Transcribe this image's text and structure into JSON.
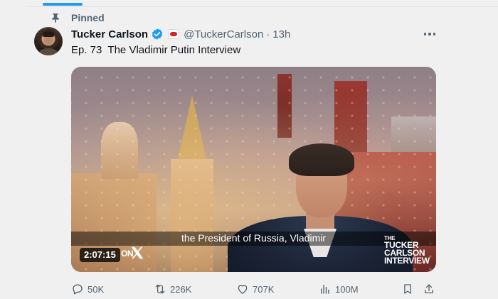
{
  "colors": {
    "accent": "#1d9bf0",
    "muted": "#536471",
    "text": "#0f1419"
  },
  "pinned": {
    "label": "Pinned",
    "icon": "pin-icon"
  },
  "tweet": {
    "display_name": "Tucker Carlson",
    "handle": "@TuckerCarlson",
    "separator": "·",
    "time": "13h",
    "text": "Ep. 73  The Vladimir Putin Interview"
  },
  "media": {
    "caption": "the President of Russia, Vladimir",
    "duration": "2:07:15",
    "brand_fragment": "ON",
    "watermark": {
      "line1": "THE",
      "line2": "TUCKER",
      "line3": "CARLSON",
      "line4": "INTERVIEW"
    }
  },
  "actions": {
    "replies": "50K",
    "reposts": "226K",
    "likes": "707K",
    "views": "100M"
  }
}
